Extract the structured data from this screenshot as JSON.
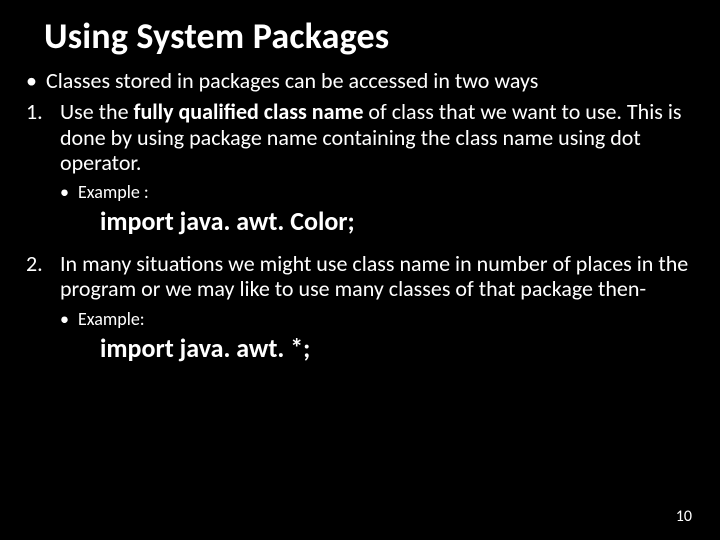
{
  "title": "Using System Packages",
  "intro_bullet": "Classes stored in packages can be accessed in two ways",
  "items": [
    {
      "num": "1.",
      "pre": "Use the ",
      "bold": "fully qualified class name",
      "post": " of class that we want to use. This is done by using package name containing the class name using dot operator.",
      "example_label": "Example :",
      "code": "import java. awt. Color;"
    },
    {
      "num": "2.",
      "pre": "",
      "bold": "",
      "post": "In many situations we might use class name in number of places in the program or we may like to use many classes of that package then-",
      "example_label": "Example:",
      "code": "import java. awt. *;"
    }
  ],
  "page_number": "10",
  "marks": {
    "dot": "•"
  }
}
